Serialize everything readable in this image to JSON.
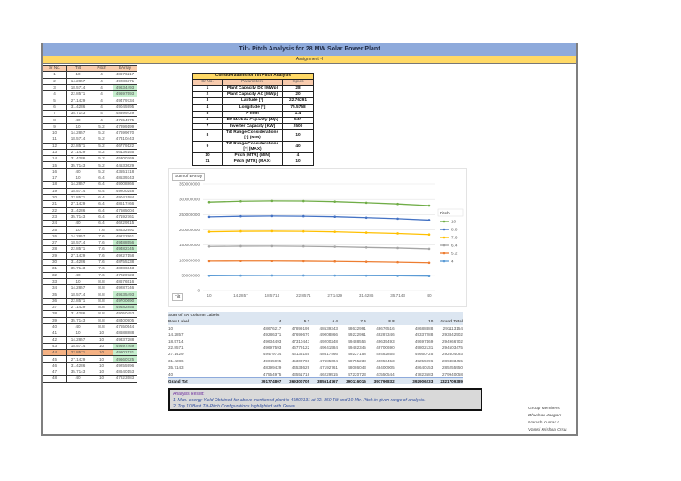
{
  "title": "Tilt- Pitch Analysis for 28 MW Solar Power Plant",
  "assignment": "Assignment -I",
  "energy_table": {
    "headers": [
      "Sr No.",
      "Tilt",
      "Pitch",
      "EArray"
    ],
    "rows": [
      {
        "sr": "1",
        "tilt": "10",
        "pitch": "4",
        "earray": "48676217",
        "hl": ""
      },
      {
        "sr": "2",
        "tilt": "14.2857",
        "pitch": "4",
        "earray": "49286371",
        "hl": ""
      },
      {
        "sr": "3",
        "tilt": "18.5714",
        "pitch": "4",
        "earray": "49634493",
        "hl": "green"
      },
      {
        "sr": "4",
        "tilt": "22.8571",
        "pitch": "4",
        "earray": "49697593",
        "hl": "green"
      },
      {
        "sr": "5",
        "tilt": "27.1429",
        "pitch": "4",
        "earray": "49479734",
        "hl": ""
      },
      {
        "sr": "6",
        "tilt": "31.4286",
        "pitch": "4",
        "earray": "49045995",
        "hl": ""
      },
      {
        "sr": "7",
        "tilt": "35.7143",
        "pitch": "4",
        "earray": "48399429",
        "hl": ""
      },
      {
        "sr": "8",
        "tilt": "40",
        "pitch": "4",
        "earray": "47554975",
        "hl": ""
      },
      {
        "sr": "9",
        "tilt": "10",
        "pitch": "5.2",
        "earray": "47899199",
        "hl": ""
      },
      {
        "sr": "10",
        "tilt": "14.2857",
        "pitch": "5.2",
        "earray": "47699670",
        "hl": ""
      },
      {
        "sr": "11",
        "tilt": "18.5714",
        "pitch": "5.2",
        "earray": "47310443",
        "hl": ""
      },
      {
        "sr": "12",
        "tilt": "22.8571",
        "pitch": "5.2",
        "earray": "46779122",
        "hl": ""
      },
      {
        "sr": "13",
        "tilt": "27.1429",
        "pitch": "5.2",
        "earray": "46136155",
        "hl": ""
      },
      {
        "sr": "14",
        "tilt": "31.4286",
        "pitch": "5.2",
        "earray": "45300769",
        "hl": ""
      },
      {
        "sr": "15",
        "tilt": "35.7143",
        "pitch": "5.2",
        "earray": "44533629",
        "hl": ""
      },
      {
        "sr": "16",
        "tilt": "40",
        "pitch": "5.2",
        "earray": "43551718",
        "hl": ""
      },
      {
        "sr": "17",
        "tilt": "10",
        "pitch": "6.4",
        "earray": "48539343",
        "hl": ""
      },
      {
        "sr": "18",
        "tilt": "14.2857",
        "pitch": "6.4",
        "earray": "49008866",
        "hl": ""
      },
      {
        "sr": "19",
        "tilt": "18.5714",
        "pitch": "6.4",
        "earray": "49200248",
        "hl": ""
      },
      {
        "sr": "20",
        "tilt": "22.8571",
        "pitch": "6.4",
        "earray": "49041584",
        "hl": ""
      },
      {
        "sr": "21",
        "tilt": "27.1429",
        "pitch": "6.4",
        "earray": "48617466",
        "hl": ""
      },
      {
        "sr": "22",
        "tilt": "31.4286",
        "pitch": "6.4",
        "earray": "47685004",
        "hl": ""
      },
      {
        "sr": "23",
        "tilt": "35.7143",
        "pitch": "6.4",
        "earray": "47192761",
        "hl": ""
      },
      {
        "sr": "24",
        "tilt": "40",
        "pitch": "6.4",
        "earray": "46229515",
        "hl": ""
      },
      {
        "sr": "25",
        "tilt": "10",
        "pitch": "7.6",
        "earray": "48632991",
        "hl": ""
      },
      {
        "sr": "26",
        "tilt": "14.2857",
        "pitch": "7.6",
        "earray": "49222961",
        "hl": ""
      },
      {
        "sr": "27",
        "tilt": "18.5714",
        "pitch": "7.6",
        "earray": "49488556",
        "hl": "green"
      },
      {
        "sr": "28",
        "tilt": "22.8571",
        "pitch": "7.6",
        "earray": "49482345",
        "hl": "green"
      },
      {
        "sr": "29",
        "tilt": "27.1429",
        "pitch": "7.6",
        "earray": "49227158",
        "hl": ""
      },
      {
        "sr": "30",
        "tilt": "31.4286",
        "pitch": "7.6",
        "earray": "48755238",
        "hl": ""
      },
      {
        "sr": "31",
        "tilt": "35.7143",
        "pitch": "7.6",
        "earray": "48086043",
        "hl": ""
      },
      {
        "sr": "32",
        "tilt": "40",
        "pitch": "7.6",
        "earray": "47220723",
        "hl": ""
      },
      {
        "sr": "33",
        "tilt": "10",
        "pitch": "8.8",
        "earray": "48676516",
        "hl": ""
      },
      {
        "sr": "34",
        "tilt": "14.2857",
        "pitch": "8.8",
        "earray": "49287346",
        "hl": ""
      },
      {
        "sr": "35",
        "tilt": "18.5714",
        "pitch": "8.8",
        "earray": "49635493",
        "hl": "green"
      },
      {
        "sr": "36",
        "tilt": "22.8571",
        "pitch": "8.8",
        "earray": "49700690",
        "hl": "green"
      },
      {
        "sr": "37",
        "tilt": "27.1429",
        "pitch": "8.8",
        "earray": "49482855",
        "hl": "green"
      },
      {
        "sr": "38",
        "tilt": "31.4286",
        "pitch": "8.8",
        "earray": "49050453",
        "hl": ""
      },
      {
        "sr": "39",
        "tilt": "35.7143",
        "pitch": "8.8",
        "earray": "48400905",
        "hl": ""
      },
      {
        "sr": "40",
        "tilt": "40",
        "pitch": "8.8",
        "earray": "47550544",
        "hl": ""
      },
      {
        "sr": "41",
        "tilt": "10",
        "pitch": "10",
        "earray": "48688888",
        "hl": ""
      },
      {
        "sr": "42",
        "tilt": "14.2857",
        "pitch": "10",
        "earray": "49337288",
        "hl": ""
      },
      {
        "sr": "43",
        "tilt": "18.5714",
        "pitch": "10",
        "earray": "49697469",
        "hl": "green"
      },
      {
        "sr": "44",
        "tilt": "22.8571",
        "pitch": "10",
        "earray": "49802131",
        "hl": "green",
        "best": true
      },
      {
        "sr": "45",
        "tilt": "27.1429",
        "pitch": "10",
        "earray": "49660725",
        "hl": "green"
      },
      {
        "sr": "46",
        "tilt": "31.4286",
        "pitch": "10",
        "earray": "49255996",
        "hl": ""
      },
      {
        "sr": "47",
        "tilt": "35.7143",
        "pitch": "10",
        "earray": "48640153",
        "hl": ""
      },
      {
        "sr": "48",
        "tilt": "40",
        "pitch": "10",
        "earray": "47823583",
        "hl": ""
      }
    ]
  },
  "considerations": {
    "title": "Considerations for Tilt Pitch Analysis",
    "headers": [
      "Sr No.",
      "Parameters",
      "Inputs"
    ],
    "rows": [
      {
        "sr": "1",
        "param": "Plant Capacity DC [MWp]",
        "input": "28"
      },
      {
        "sr": "2",
        "param": "Plant Capacity AC [MWp]",
        "input": "20"
      },
      {
        "sr": "3",
        "param": "Latitude [°]",
        "input": "22.76291"
      },
      {
        "sr": "4",
        "param": "Longitude [°]",
        "input": "75.5758"
      },
      {
        "sr": "5",
        "param": "P nom",
        "input": "1.4"
      },
      {
        "sr": "6",
        "param": "PV Module Capacity [Wp]",
        "input": "540"
      },
      {
        "sr": "7",
        "param": "Inverter Capacity [KW]",
        "input": "2500"
      },
      {
        "sr": "8",
        "param": "Tilt Range Considerations [°] (MIN)",
        "input": "10"
      },
      {
        "sr": "9",
        "param": "Tilt Range Considerations [°] (MAX)",
        "input": "40"
      },
      {
        "sr": "10",
        "param": "Pitch [MTR] (MIN)",
        "input": "4"
      },
      {
        "sr": "11",
        "param": "Pitch [MTR] (MAX)",
        "input": "10"
      }
    ]
  },
  "chart_data": {
    "type": "line",
    "stacked": true,
    "title": "Sum of EArray",
    "xlabel": "Tilt",
    "legend_title": "Pitch",
    "legend_position": "right",
    "grid": true,
    "categories": [
      "10",
      "14.2857",
      "18.5714",
      "22.8571",
      "27.1429",
      "31.4286",
      "35.7143",
      "40"
    ],
    "ylim": [
      0,
      350000000
    ],
    "yticks": [
      "0",
      "50000000",
      "100000000",
      "150000000",
      "200000000",
      "250000000",
      "300000000",
      "350000000"
    ],
    "series": [
      {
        "name": "4",
        "color": "#5b9bd5",
        "values": [
          48676217,
          49286371,
          49634493,
          49697593,
          49479734,
          49045995,
          48399429,
          47554975
        ]
      },
      {
        "name": "5.2",
        "color": "#ed7d31",
        "values": [
          47899199,
          47699670,
          47310443,
          46779122,
          46136155,
          45300769,
          44533629,
          43551718
        ]
      },
      {
        "name": "6.4",
        "color": "#a5a5a5",
        "values": [
          48539343,
          49008866,
          49200248,
          49041584,
          48617466,
          47685004,
          47192761,
          46229515
        ]
      },
      {
        "name": "7.6",
        "color": "#ffc000",
        "values": [
          48632991,
          49222961,
          49488556,
          49482345,
          49227158,
          48755238,
          48086043,
          47220723
        ]
      },
      {
        "name": "8.8",
        "color": "#4472c4",
        "values": [
          48676516,
          49287346,
          49635493,
          49700690,
          49482855,
          49050453,
          48400905,
          47550544
        ]
      },
      {
        "name": "10",
        "color": "#70ad47",
        "values": [
          48688888,
          49337288,
          49697469,
          49802131,
          49660725,
          49255996,
          48640153,
          47823583
        ]
      }
    ]
  },
  "pivot": {
    "value_label": "Sum of EA",
    "column_labels": "Column Labels",
    "row_labels": "Row Label",
    "columns": [
      "4",
      "5.2",
      "6.4",
      "7.6",
      "8.8",
      "10"
    ],
    "grand_total_label": "Grand Total",
    "rows": [
      {
        "label": "10",
        "values": [
          "48676217",
          "47899199",
          "48539343",
          "48632991",
          "48676516",
          "48688888"
        ],
        "total": "291113154"
      },
      {
        "label": "14.2857",
        "values": [
          "49286371",
          "47699670",
          "49008866",
          "49222961",
          "49287346",
          "49337288"
        ],
        "total": "293842502"
      },
      {
        "label": "18.5714",
        "values": [
          "49634493",
          "47310443",
          "49200248",
          "49488556",
          "49635493",
          "49697469"
        ],
        "total": "294966702"
      },
      {
        "label": "22.8571",
        "values": [
          "49697593",
          "46779122",
          "49041584",
          "49482345",
          "49700690",
          "49802131"
        ],
        "total": "294503475"
      },
      {
        "label": "27.1429",
        "values": [
          "49479734",
          "46136155",
          "48617466",
          "49227158",
          "49482855",
          "49660725"
        ],
        "total": "292604093"
      },
      {
        "label": "31.4286",
        "values": [
          "49045995",
          "45300769",
          "47685004",
          "48755238",
          "49050453",
          "49255996"
        ],
        "total": "289483455"
      },
      {
        "label": "35.7143",
        "values": [
          "48399429",
          "44533629",
          "47192761",
          "48086043",
          "48400905",
          "48640153"
        ],
        "total": "285255950"
      },
      {
        "label": "40",
        "values": [
          "47554975",
          "43551718",
          "46229515",
          "47220723",
          "47550544",
          "47823583"
        ],
        "total": "279940058"
      }
    ],
    "grand_row": {
      "label": "Grand Tot",
      "values": [
        "391774807",
        "369300705",
        "385514767",
        "390116015",
        "391796832",
        "392906233"
      ],
      "total": "2321709389"
    }
  },
  "analysis": {
    "heading": "Analysis Result:",
    "lines": [
      "1. Max. energy Yield Obtained for above mentioned plant is 49802131 at 22. 850 Tilt and 10 Mtr. Pitch.in given range of analysis.",
      "2. Top 10 Best Tilt-Pitch Configurations highlighted with Green."
    ]
  },
  "group": {
    "heading": "Group Members",
    "members": [
      "Bhushan Jangam",
      "Naresh Kumar L.",
      "Vamsi Krishna Orsu."
    ]
  }
}
